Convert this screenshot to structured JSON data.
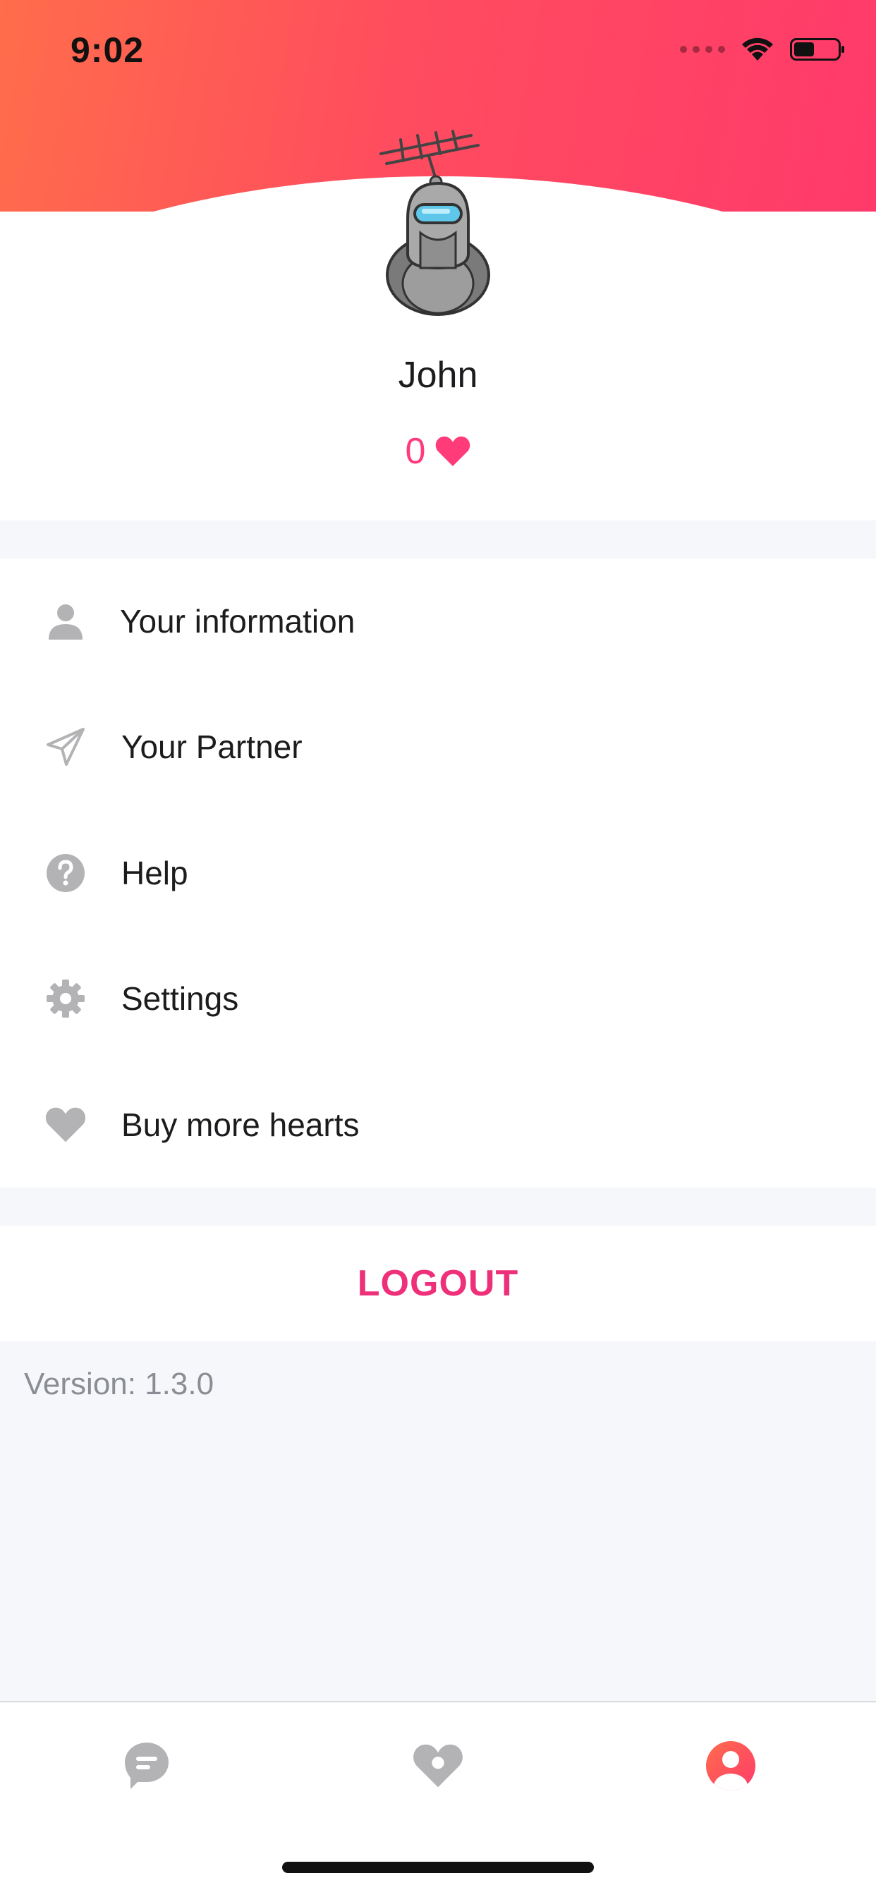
{
  "status_bar": {
    "time": "9:02"
  },
  "profile": {
    "name": "John",
    "hearts_count": "0",
    "avatar_icon": "robot-avatar",
    "heart_icon": "heart-icon"
  },
  "menu": {
    "items": [
      {
        "label": "Your information",
        "icon": "person-icon"
      },
      {
        "label": "Your Partner",
        "icon": "paper-plane-icon"
      },
      {
        "label": "Help",
        "icon": "question-circle-icon"
      },
      {
        "label": "Settings",
        "icon": "gear-icon"
      },
      {
        "label": "Buy more hearts",
        "icon": "heart-icon"
      }
    ]
  },
  "logout_label": "LOGOUT",
  "version_text": "Version: 1.3.0",
  "tab_bar": {
    "tabs": [
      {
        "icon": "chat-bubble-icon",
        "active": false
      },
      {
        "icon": "heart-tab-icon",
        "active": false
      },
      {
        "icon": "profile-tab-icon",
        "active": true
      }
    ]
  },
  "colors": {
    "accent": "#ee2f79",
    "header_gradient_start": "#ff6d4b",
    "header_gradient_end": "#ff3a6b",
    "icon_gray": "#b3b3b6",
    "background": "#f6f7fa"
  }
}
